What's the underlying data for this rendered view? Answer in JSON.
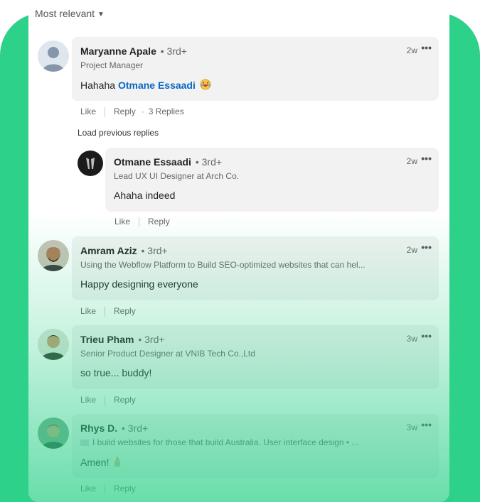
{
  "sort": {
    "label": "Most relevant"
  },
  "comments": [
    {
      "name": "Maryanne Apale",
      "degree": "• 3rd+",
      "headline": "Project Manager",
      "text_prefix": "Hahaha ",
      "mention": "Otmane Essaadi",
      "time": "2w",
      "like": "Like",
      "reply": "Reply",
      "replies": "3 Replies"
    },
    {
      "name": "Otmane Essaadi",
      "degree": "• 3rd+",
      "headline": "Lead UX UI Designer at Arch Co.",
      "text": "Ahaha indeed",
      "time": "2w",
      "like": "Like",
      "reply": "Reply"
    },
    {
      "name": "Amram Aziz",
      "degree": "• 3rd+",
      "headline": "Using the Webflow Platform to Build SEO-optimized websites that can hel...",
      "text": "Happy designing everyone",
      "time": "2w",
      "like": "Like",
      "reply": "Reply"
    },
    {
      "name": "Trieu Pham",
      "degree": "• 3rd+",
      "headline": "Senior Product Designer at VNIB Tech Co.,Ltd",
      "text": "so true... buddy!",
      "time": "3w",
      "like": "Like",
      "reply": "Reply"
    },
    {
      "name": "Rhys D.",
      "degree": "• 3rd+",
      "headline": "I build websites for those that build Australia. User interface design • ...",
      "text": "Amen!",
      "time": "3w",
      "like": "Like",
      "reply": "Reply"
    }
  ],
  "load_previous": "Load previous replies",
  "more_glyph": "•••",
  "colors": {
    "accent_green": "#2ed18a",
    "mention_blue": "#0a66c2",
    "bubble": "#f2f2f2"
  }
}
